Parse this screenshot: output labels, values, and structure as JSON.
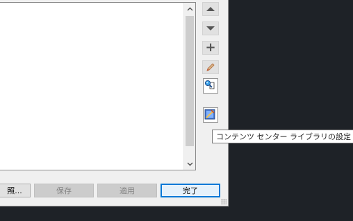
{
  "list": {
    "scroll_up_icon": "chevron-up",
    "scroll_down_icon": "chevron-down"
  },
  "side_buttons": [
    {
      "name": "move-up",
      "icon": "triangle-up"
    },
    {
      "name": "move-down",
      "icon": "triangle-down"
    },
    {
      "name": "add",
      "icon": "plus",
      "glyph": "+"
    },
    {
      "name": "edit",
      "icon": "pencil"
    },
    {
      "name": "search-path",
      "icon": "magnifier-document"
    },
    {
      "name": "content-library-settings",
      "icon": "library-settings"
    }
  ],
  "buttons": {
    "browse_label": "照...",
    "save_label": "保存",
    "apply_label": "適用",
    "done_label": "完了"
  },
  "tooltip": {
    "text": "コンテンツ センター ライブラリの設定"
  },
  "colors": {
    "background": "#1e2227",
    "dialog": "#f0f0f0",
    "accent": "#0078d7"
  }
}
